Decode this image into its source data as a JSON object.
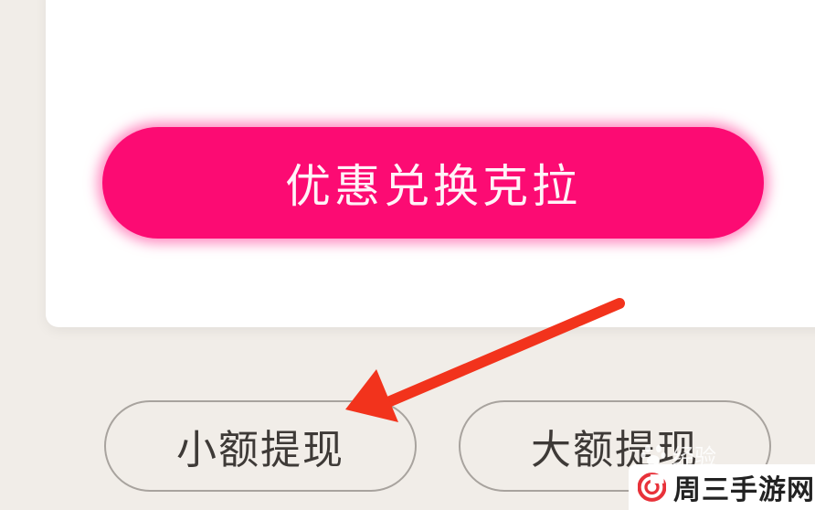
{
  "card": {
    "exchange_button_label": "优惠兑换克拉"
  },
  "withdraw": {
    "small_label": "小额提现",
    "large_label": "大额提现"
  },
  "watermark": {
    "baidu_text": "经验",
    "site_name": "周三手游网"
  },
  "colors": {
    "exchange_button": "#fc0b73",
    "arrow": "#f2331c",
    "page_bg": "#f1ede8"
  },
  "icons": {
    "arrow": "red-arrow-icon",
    "paw": "baidu-paw-icon",
    "site_logo": "site-logo-icon"
  }
}
